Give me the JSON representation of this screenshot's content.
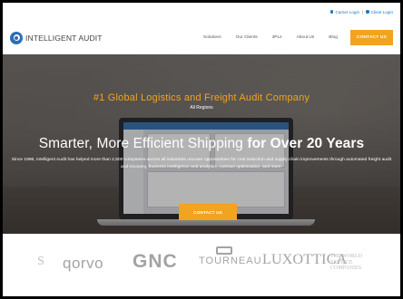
{
  "utility_bar": {
    "carrier_login": "Carrier Login",
    "separator": "|",
    "client_login": "Client Login"
  },
  "header": {
    "logo_text": "INTELLIGENT AUDIT",
    "nav": [
      "Solutions",
      "Our Clients",
      "3PLs",
      "About Us",
      "Blog"
    ],
    "contact_button": "CONTACT US"
  },
  "hero": {
    "tagline": "#1 Global Logistics and Freight Audit Company",
    "region": "All Regions",
    "title_regular": "Smarter, More Efficient Shipping ",
    "title_bold": "for Over 20 Years",
    "description": "Since 1996, Intelligent Audit has helped more than 2,500 companies across all industries uncover opportunities for cost reduction and supply chain improvements through automated freight audit and recovery, business intelligence and analytics, contract optimization, and more.",
    "cta_button": "CONTACT US"
  },
  "clients": {
    "logos": [
      "S",
      "qorvo",
      "GNC",
      "TOURNEAU",
      "LUXOTTICA",
      "THE WORLD SERVICE COMPANIES"
    ]
  },
  "colors": {
    "accent": "#f2a31f",
    "link": "#1a78c2",
    "brand_blue": "#2b6fb6"
  },
  "icons": {
    "logo": "intelligent-audit-logo-icon",
    "login": "user-dot-icon"
  }
}
